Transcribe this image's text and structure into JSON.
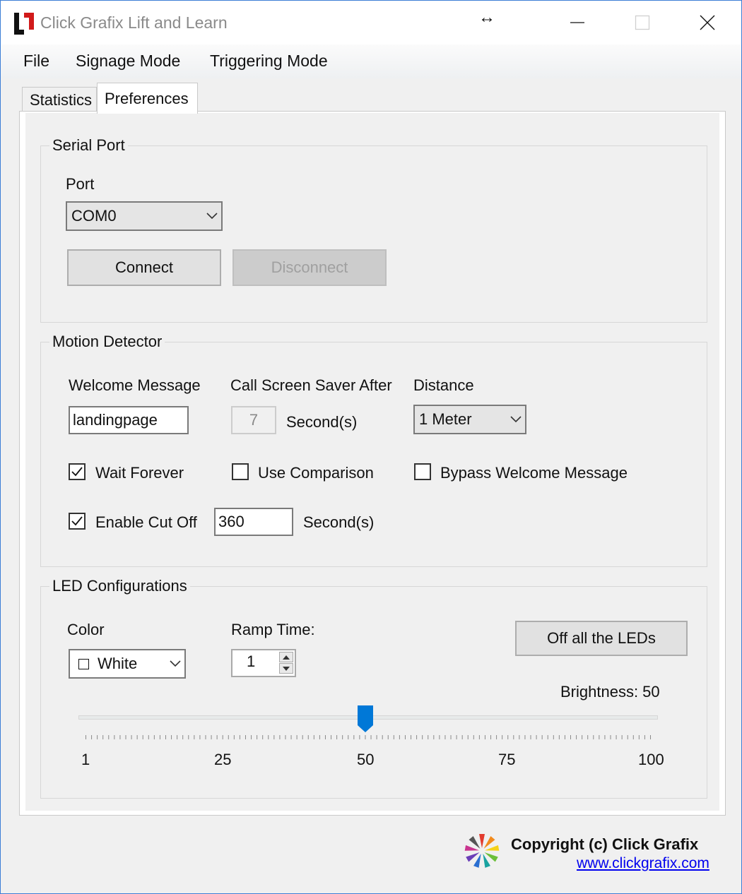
{
  "window": {
    "title": "Click Grafix Lift and Learn"
  },
  "menu": {
    "items": [
      "File",
      "Signage Mode",
      "Triggering Mode"
    ]
  },
  "tabs": [
    {
      "label": "Statistics",
      "selected": false
    },
    {
      "label": "Preferences",
      "selected": true
    }
  ],
  "serial_port": {
    "group_label": "Serial Port",
    "port_label": "Port",
    "port_value": "COM0",
    "connect_label": "Connect",
    "disconnect_label": "Disconnect"
  },
  "motion_detector": {
    "group_label": "Motion Detector",
    "welcome_label": "Welcome Message",
    "welcome_value": "landingpage",
    "screensaver_label": "Call Screen Saver After",
    "screensaver_value": "7",
    "screensaver_unit": "Second(s)",
    "distance_label": "Distance",
    "distance_value": "1 Meter",
    "wait_forever_label": "Wait Forever",
    "wait_forever_checked": true,
    "use_comparison_label": "Use Comparison",
    "use_comparison_checked": false,
    "bypass_label": "Bypass Welcome Message",
    "bypass_checked": false,
    "cutoff_label": "Enable Cut Off",
    "cutoff_checked": true,
    "cutoff_value": "360",
    "cutoff_unit": "Second(s)"
  },
  "led": {
    "group_label": "LED Configurations",
    "color_label": "Color",
    "color_value": "White",
    "ramp_label": "Ramp Time:",
    "ramp_value": "1",
    "off_button_label": "Off all the LEDs",
    "brightness_label": "Brightness: 50",
    "brightness_value": 50,
    "slider_min": 1,
    "slider_max": 100,
    "tick_labels": [
      "1",
      "25",
      "50",
      "75",
      "100"
    ]
  },
  "footer": {
    "copyright": "Copyright (c) Click Grafix",
    "website": "www.clickgrafix.com"
  },
  "colors": {
    "accent": "#0078d7",
    "window_border": "#3c7ed6",
    "link": "#0000ee"
  }
}
